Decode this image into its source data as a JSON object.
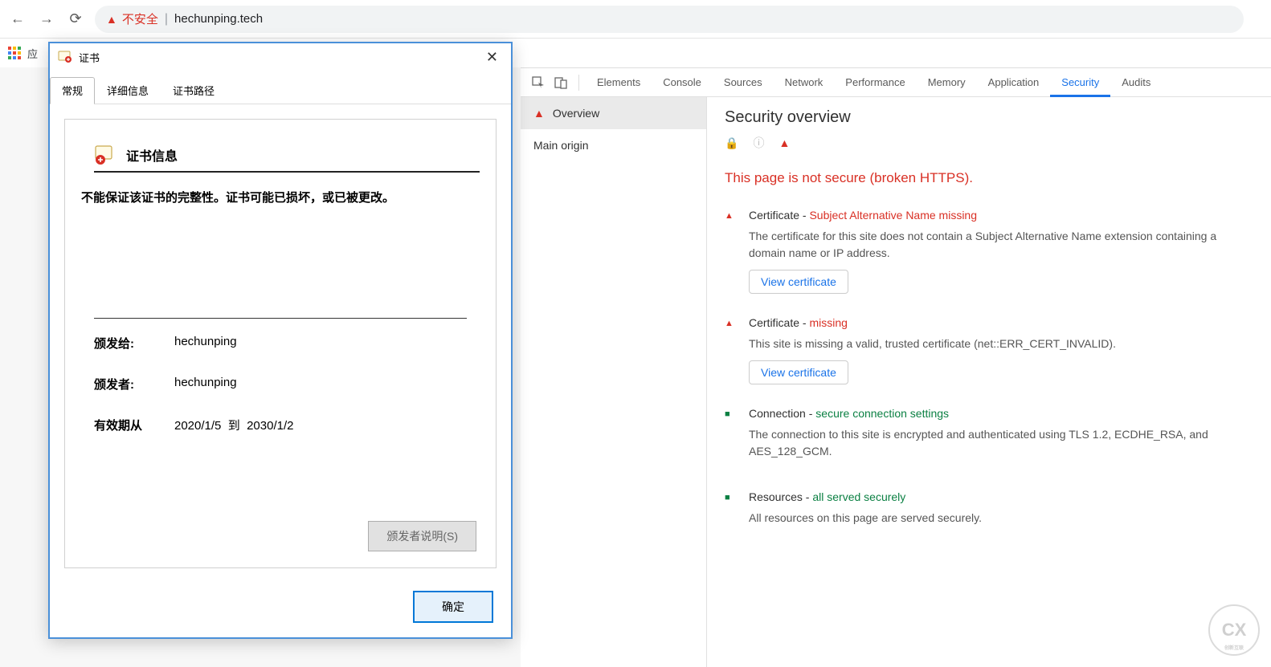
{
  "browser": {
    "not_secure_label": "不安全",
    "url": "hechunping.tech",
    "bookmark_label": "应"
  },
  "devtools": {
    "tabs": [
      "Elements",
      "Console",
      "Sources",
      "Network",
      "Performance",
      "Memory",
      "Application",
      "Security",
      "Audits"
    ],
    "active_tab": "Security",
    "sidebar": {
      "overview": "Overview",
      "main_origin": "Main origin"
    },
    "content": {
      "title": "Security overview",
      "headline": "This page is not secure (broken HTTPS).",
      "blocks": [
        {
          "icon": "red",
          "label": "Certificate",
          "sub": "Subject Alternative Name missing",
          "sub_color": "red",
          "desc": "The certificate for this site does not contain a Subject Alternative Name extension containing a domain name or IP address.",
          "button": "View certificate"
        },
        {
          "icon": "red",
          "label": "Certificate",
          "sub": "missing",
          "sub_color": "red",
          "desc": "This site is missing a valid, trusted certificate (net::ERR_CERT_INVALID).",
          "button": "View certificate"
        },
        {
          "icon": "green",
          "label": "Connection",
          "sub": "secure connection settings",
          "sub_color": "green",
          "desc": "The connection to this site is encrypted and authenticated using TLS 1.2, ECDHE_RSA, and AES_128_GCM."
        },
        {
          "icon": "green",
          "label": "Resources",
          "sub": "all served securely",
          "sub_color": "green",
          "desc": "All resources on this page are served securely."
        }
      ]
    }
  },
  "cert_dialog": {
    "title": "证书",
    "tabs": [
      "常规",
      "详细信息",
      "证书路径"
    ],
    "info_header": "证书信息",
    "warning": "不能保证该证书的完整性。证书可能已损坏，或已被更改。",
    "issued_to_label": "颁发给:",
    "issued_to_value": "hechunping",
    "issued_by_label": "颁发者:",
    "issued_by_value": "hechunping",
    "validity_label": "有效期从",
    "validity_from": "2020/1/5",
    "validity_to_word": "到",
    "validity_to": "2030/1/2",
    "issuer_statement_btn": "颁发者说明(S)",
    "ok_btn": "确定"
  },
  "watermark": {
    "big": "CX",
    "small": "创新互联"
  }
}
